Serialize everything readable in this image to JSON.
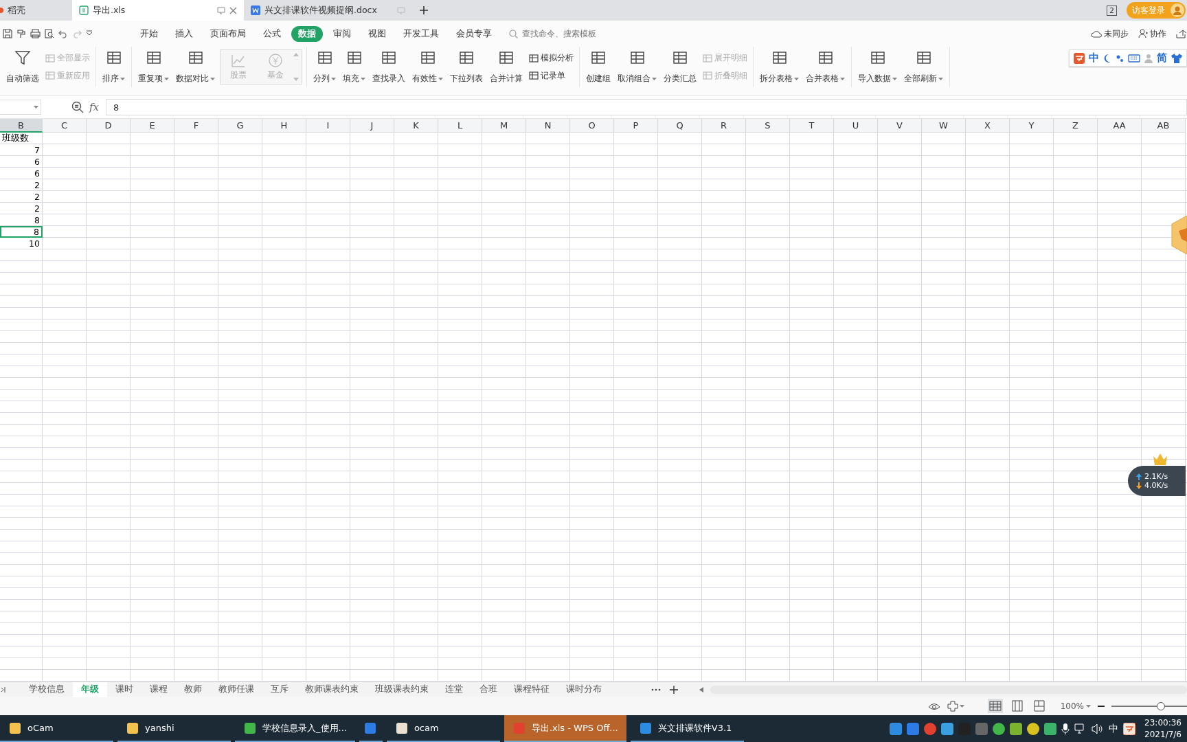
{
  "doc_tabs": [
    {
      "label": "稻壳",
      "selected": false
    },
    {
      "label": "导出.xls",
      "selected": true
    },
    {
      "label": "兴文排课软件视频提纲.docx",
      "selected": false
    }
  ],
  "window_count": "2",
  "login_button": "访客登录",
  "menu": [
    {
      "label": "开始",
      "selected": false
    },
    {
      "label": "插入",
      "selected": false
    },
    {
      "label": "页面布局",
      "selected": false
    },
    {
      "label": "公式",
      "selected": false
    },
    {
      "label": "数据",
      "selected": true
    },
    {
      "label": "审阅",
      "selected": false
    },
    {
      "label": "视图",
      "selected": false
    },
    {
      "label": "开发工具",
      "selected": false
    },
    {
      "label": "会员专享",
      "selected": false
    }
  ],
  "search": {
    "placeholder": "查找命令、搜索模板"
  },
  "actions": [
    "未同步",
    "协作"
  ],
  "ribbon": [
    {
      "items": [
        {
          "kind": "large",
          "label": "自动筛选",
          "dropdown": false
        },
        {
          "kind": "stack",
          "items": [
            {
              "label": "全部显示",
              "disabled": true
            },
            {
              "label": "重新应用",
              "disabled": true
            }
          ]
        }
      ]
    },
    {
      "items": [
        {
          "kind": "large",
          "label": "排序",
          "dropdown": true
        }
      ]
    },
    {
      "items": [
        {
          "kind": "large",
          "label": "重复项",
          "dropdown": true
        },
        {
          "kind": "large",
          "label": "数据对比",
          "dropdown": true
        },
        {
          "kind": "gallery",
          "items": [
            {
              "label": "股票",
              "disabled": true
            },
            {
              "label": "基金",
              "disabled": true
            }
          ]
        }
      ]
    },
    {
      "items": [
        {
          "kind": "large",
          "label": "分列",
          "dropdown": true
        },
        {
          "kind": "large",
          "label": "填充",
          "dropdown": true
        },
        {
          "kind": "large",
          "label": "查找录入",
          "dropdown": false
        },
        {
          "kind": "large",
          "label": "有效性",
          "dropdown": true
        },
        {
          "kind": "large",
          "label": "下拉列表",
          "dropdown": false
        },
        {
          "kind": "large",
          "label": "合并计算",
          "dropdown": false
        },
        {
          "kind": "stack",
          "items": [
            {
              "label": "模拟分析",
              "disabled": false
            },
            {
              "label": "记录单",
              "disabled": false
            }
          ]
        }
      ]
    },
    {
      "items": [
        {
          "kind": "large",
          "label": "创建组",
          "dropdown": false
        },
        {
          "kind": "large",
          "label": "取消组合",
          "dropdown": true
        },
        {
          "kind": "large",
          "label": "分类汇总",
          "dropdown": false
        },
        {
          "kind": "stack",
          "items": [
            {
              "label": "展开明细",
              "disabled": true
            },
            {
              "label": "折叠明细",
              "disabled": true
            }
          ]
        }
      ]
    },
    {
      "items": [
        {
          "kind": "large",
          "label": "拆分表格",
          "dropdown": true
        },
        {
          "kind": "large",
          "label": "合并表格",
          "dropdown": true
        }
      ]
    },
    {
      "items": [
        {
          "kind": "large",
          "label": "导入数据",
          "dropdown": true
        },
        {
          "kind": "large",
          "label": "全部刷新",
          "dropdown": true
        }
      ]
    }
  ],
  "ime_bar": [
    "中",
    "简"
  ],
  "formula_bar": {
    "function_label": "fx",
    "value": "8"
  },
  "sheet": {
    "columns": [
      {
        "label": "B",
        "selected": true
      },
      {
        "label": "C",
        "selected": false
      },
      {
        "label": "D",
        "selected": false
      },
      {
        "label": "E",
        "selected": false
      },
      {
        "label": "F",
        "selected": false
      },
      {
        "label": "G",
        "selected": false
      },
      {
        "label": "H",
        "selected": false
      },
      {
        "label": "I",
        "selected": false
      },
      {
        "label": "J",
        "selected": false
      },
      {
        "label": "K",
        "selected": false
      },
      {
        "label": "L",
        "selected": false
      },
      {
        "label": "M",
        "selected": false
      },
      {
        "label": "N",
        "selected": false
      },
      {
        "label": "O",
        "selected": false
      },
      {
        "label": "P",
        "selected": false
      },
      {
        "label": "Q",
        "selected": false
      },
      {
        "label": "R",
        "selected": false
      },
      {
        "label": "S",
        "selected": false
      },
      {
        "label": "T",
        "selected": false
      },
      {
        "label": "U",
        "selected": false
      },
      {
        "label": "V",
        "selected": false
      },
      {
        "label": "W",
        "selected": false
      },
      {
        "label": "X",
        "selected": false
      },
      {
        "label": "Y",
        "selected": false
      },
      {
        "label": "Z",
        "selected": false
      },
      {
        "label": "AA",
        "selected": false
      },
      {
        "label": "AB",
        "selected": false
      }
    ],
    "cells": [
      {
        "value": "班级数",
        "kind": "text",
        "selected": false
      },
      {
        "value": "7",
        "kind": "number",
        "selected": false
      },
      {
        "value": "6",
        "kind": "number",
        "selected": false
      },
      {
        "value": "6",
        "kind": "number",
        "selected": false
      },
      {
        "value": "2",
        "kind": "number",
        "selected": false
      },
      {
        "value": "2",
        "kind": "number",
        "selected": false
      },
      {
        "value": "2",
        "kind": "number",
        "selected": false
      },
      {
        "value": "8",
        "kind": "number",
        "selected": false
      },
      {
        "value": "8",
        "kind": "number",
        "selected": true
      },
      {
        "value": "10",
        "kind": "number",
        "selected": false
      }
    ]
  },
  "sheet_tabs": [
    {
      "label": "学校信息",
      "selected": false
    },
    {
      "label": "年级",
      "selected": true
    },
    {
      "label": "课时",
      "selected": false
    },
    {
      "label": "课程",
      "selected": false
    },
    {
      "label": "教师",
      "selected": false
    },
    {
      "label": "教师任课",
      "selected": false
    },
    {
      "label": "互斥",
      "selected": false
    },
    {
      "label": "教师课表约束",
      "selected": false
    },
    {
      "label": "班级课表约束",
      "selected": false
    },
    {
      "label": "连堂",
      "selected": false
    },
    {
      "label": "合班",
      "selected": false
    },
    {
      "label": "课程特征",
      "selected": false
    },
    {
      "label": "课时分布",
      "selected": false
    }
  ],
  "net_speed": {
    "upload": "2.1K/s",
    "download": "4.0K/s"
  },
  "status_bar": {
    "views": [
      {
        "selected": true
      },
      {
        "selected": false
      },
      {
        "selected": false
      }
    ],
    "zoom": "100%",
    "zoom_slider": {
      "level": 0.65
    }
  },
  "taskbar": {
    "apps": [
      {
        "label": "oCam",
        "selected": false
      },
      {
        "label": "yanshi",
        "selected": false
      },
      {
        "label": "学校信息录入_使用...",
        "selected": false
      },
      {
        "selected": false
      },
      {
        "label": "ocam",
        "selected": false
      },
      {
        "label": "导出.xls - WPS Off...",
        "selected": true
      },
      {
        "label": "兴文排课软件V3.1",
        "selected": false
      }
    ],
    "tray_language": "中",
    "clock": {
      "time": "23:00:36",
      "date": "2021/7/6"
    }
  }
}
